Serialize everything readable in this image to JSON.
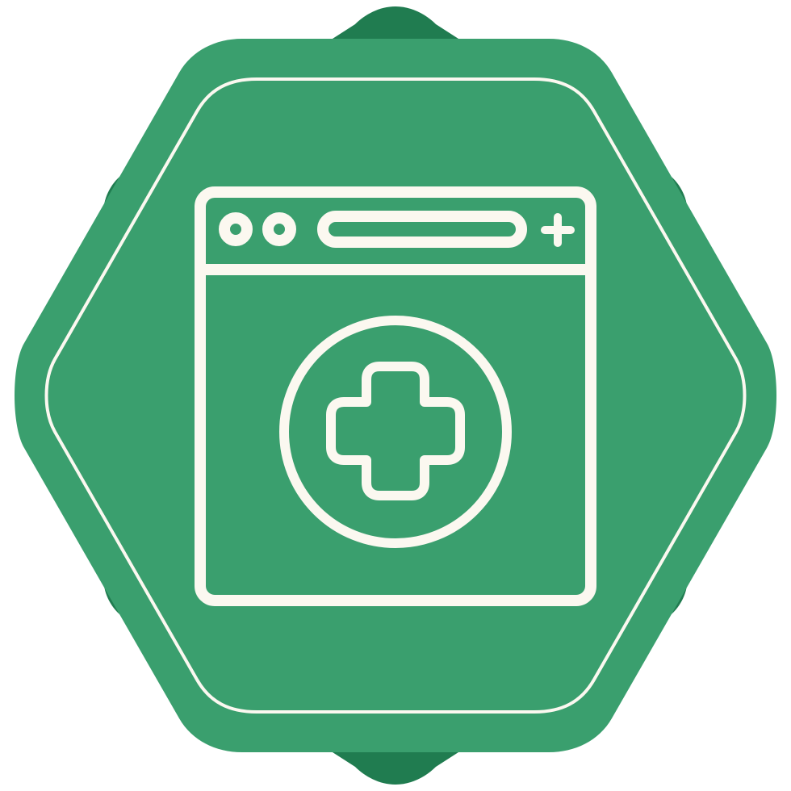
{
  "icon": {
    "name": "medical-browser-icon",
    "description_label": ""
  },
  "colors": {
    "badge_dark": "#207C50",
    "badge_light": "#3A9F6E",
    "line": "#FBF8F0"
  },
  "window": {
    "control_dots": 2,
    "has_address_bar": true,
    "has_new_tab_plus": true
  }
}
